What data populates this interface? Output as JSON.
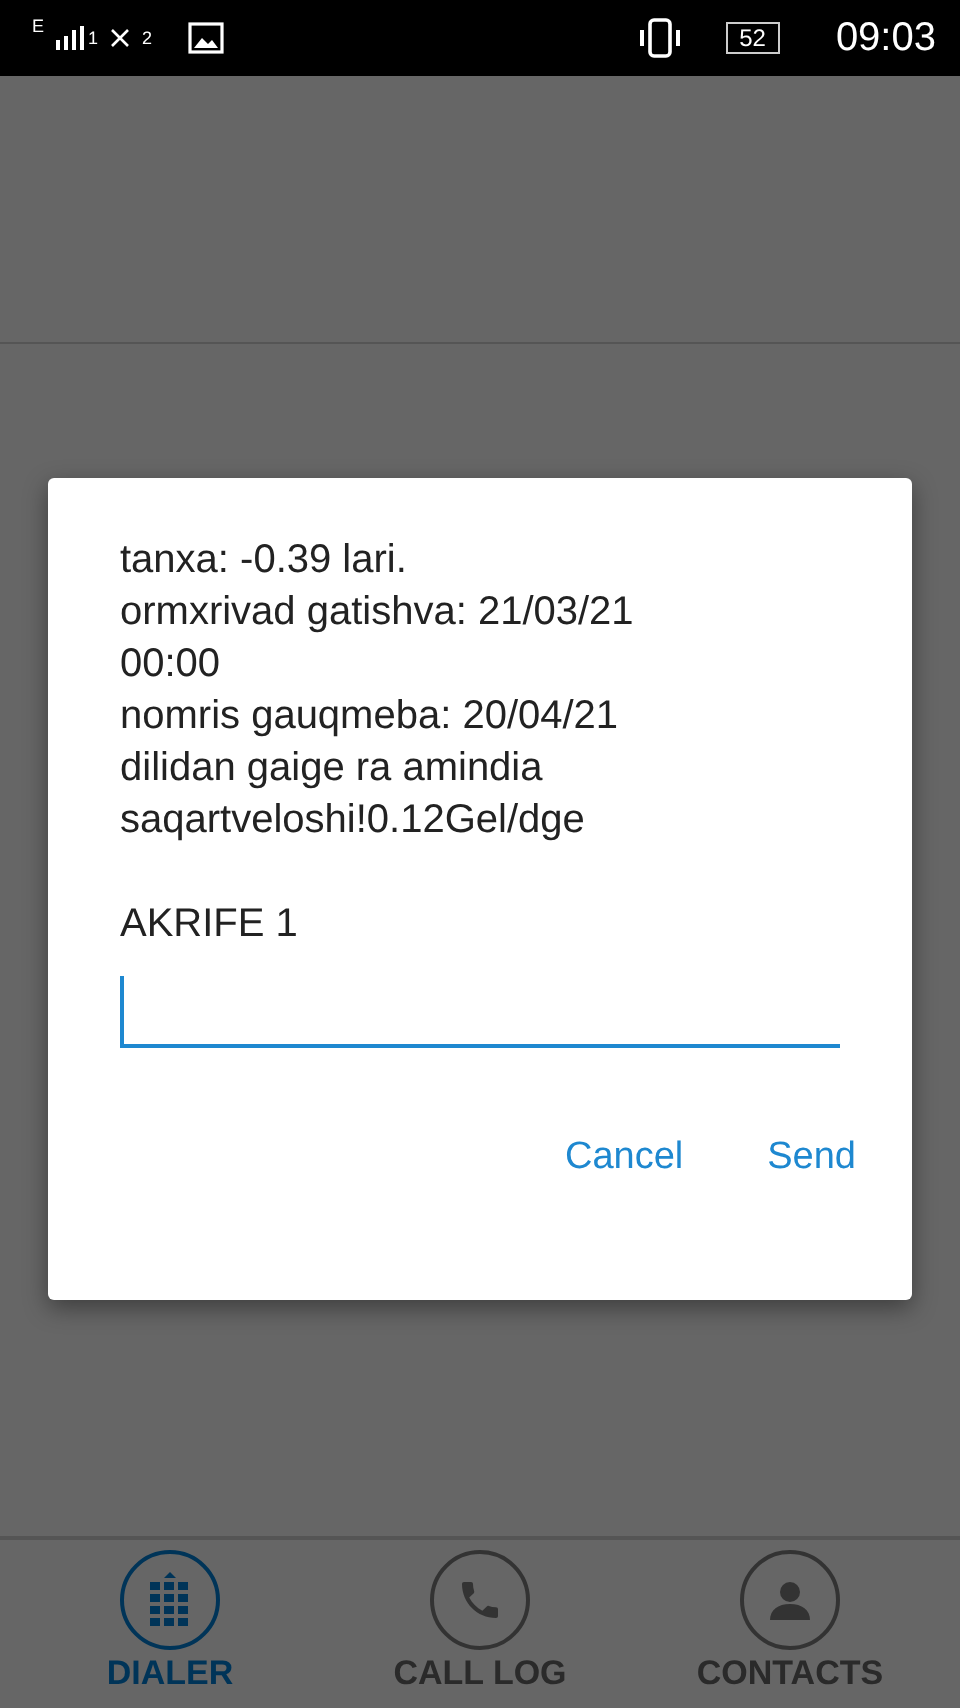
{
  "status_bar": {
    "network": "E",
    "sim1": "1",
    "sim2": "2",
    "battery": "52",
    "time": "09:03"
  },
  "dialog": {
    "message_lines": [
      "tanxa: -0.39 lari.",
      "ormxrivad gatishva: 21/03/21",
      "00:00",
      "nomris gauqmeba: 20/04/21",
      "dilidan gaige ra amindia",
      "saqartveloshi!0.12Gel/dge"
    ],
    "prompt": "AKRIFE 1",
    "buttons": [
      "Cancel",
      "Send"
    ]
  },
  "nav": [
    {
      "label": "DIALER",
      "selected": true
    },
    {
      "label": "CALL LOG",
      "selected": false
    },
    {
      "label": "CONTACTS",
      "selected": false
    }
  ]
}
